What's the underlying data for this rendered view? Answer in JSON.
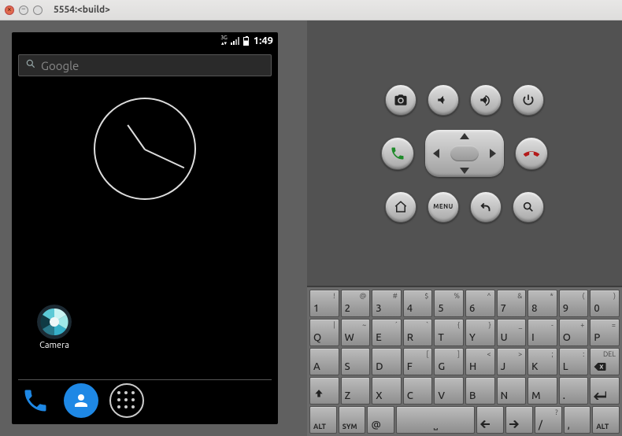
{
  "window": {
    "title": "5554:<build>"
  },
  "status": {
    "network": "3G",
    "time": "1:49"
  },
  "search": {
    "placeholder": "Google"
  },
  "apps": {
    "camera_label": "Camera"
  },
  "controls": {
    "menu_label": "MENU"
  },
  "keyboard": {
    "row1": [
      {
        "m": "1",
        "a": "!"
      },
      {
        "m": "2",
        "a": "@"
      },
      {
        "m": "3",
        "a": "#"
      },
      {
        "m": "4",
        "a": "$"
      },
      {
        "m": "5",
        "a": "%"
      },
      {
        "m": "6",
        "a": "^"
      },
      {
        "m": "7",
        "a": "&"
      },
      {
        "m": "8",
        "a": "*"
      },
      {
        "m": "9",
        "a": "("
      },
      {
        "m": "0",
        "a": ")"
      }
    ],
    "row2": [
      {
        "m": "Q",
        "a": "|"
      },
      {
        "m": "W",
        "a": "~"
      },
      {
        "m": "E",
        "a": "´"
      },
      {
        "m": "R",
        "a": "`"
      },
      {
        "m": "T",
        "a": "{"
      },
      {
        "m": "Y",
        "a": "}"
      },
      {
        "m": "U",
        "a": "_"
      },
      {
        "m": "I",
        "a": "-"
      },
      {
        "m": "O",
        "a": "+"
      },
      {
        "m": "P",
        "a": "="
      }
    ],
    "row3": [
      {
        "m": "A",
        "a": ""
      },
      {
        "m": "S",
        "a": ""
      },
      {
        "m": "D",
        "a": ""
      },
      {
        "m": "F",
        "a": "["
      },
      {
        "m": "G",
        "a": "]"
      },
      {
        "m": "H",
        "a": "<"
      },
      {
        "m": "J",
        "a": ">"
      },
      {
        "m": "K",
        "a": ";"
      },
      {
        "m": "L",
        "a": ":"
      }
    ],
    "row3_del": "DEL",
    "row4": [
      {
        "m": "Z",
        "a": ""
      },
      {
        "m": "X",
        "a": ""
      },
      {
        "m": "C",
        "a": ""
      },
      {
        "m": "V",
        "a": ""
      },
      {
        "m": "B",
        "a": ""
      },
      {
        "m": "N",
        "a": ""
      },
      {
        "m": "M",
        "a": ""
      },
      {
        "m": ".",
        "a": ""
      },
      {
        "m": "",
        "a": ""
      }
    ],
    "row5": {
      "alt_l": "ALT",
      "sym": "SYM",
      "at": "@",
      "comma": ",",
      "slash": "/",
      "q": "?",
      "alt_r": "ALT"
    }
  }
}
